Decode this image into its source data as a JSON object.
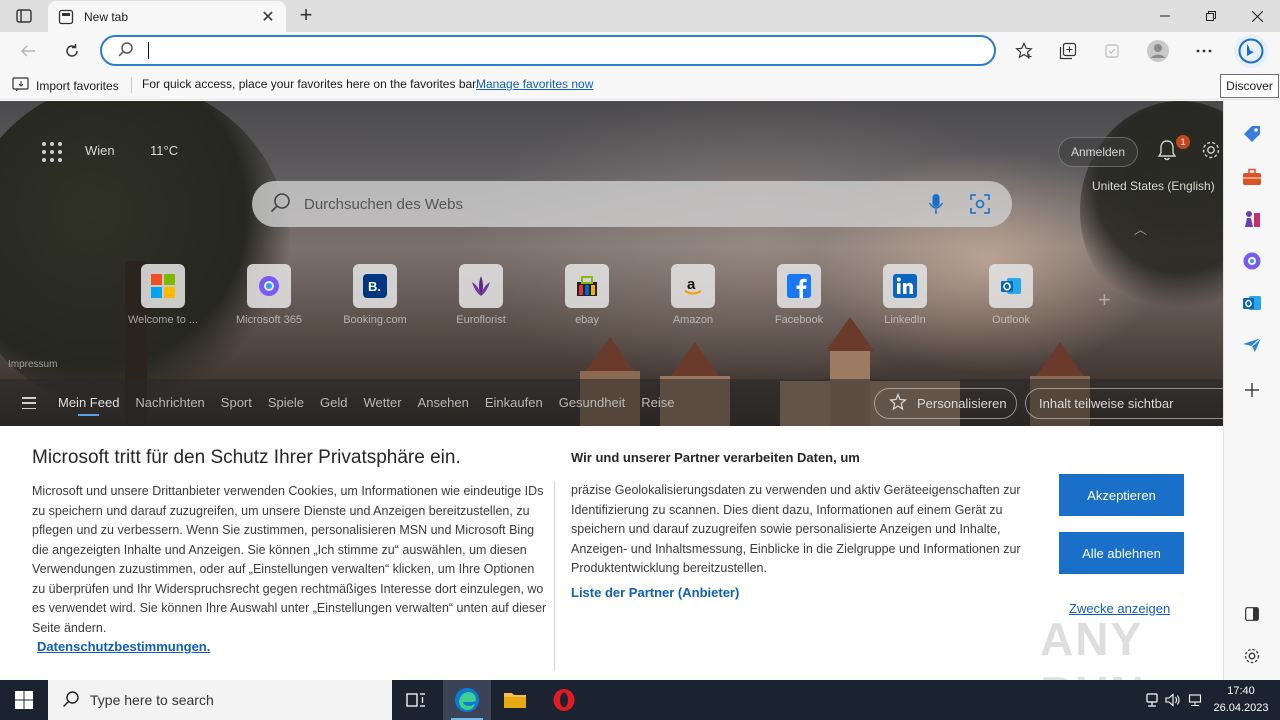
{
  "browser": {
    "tab_title": "New tab",
    "address_value": "",
    "favorites_bar": {
      "import_label": "Import favorites",
      "message": "For quick access, place your favorites here on the favorites bar.",
      "manage_link": "Manage favorites now"
    },
    "tooltip": "Discover"
  },
  "newtab": {
    "weather": {
      "city": "Wien",
      "temp": "11°C"
    },
    "signin_label": "Anmelden",
    "notification_count": "1",
    "region": "United States (English)",
    "search_placeholder": "Durchsuchen des Webs",
    "tiles": [
      {
        "label": "Welcome to ...",
        "icon": "microsoft-logo-icon"
      },
      {
        "label": "Microsoft 365",
        "icon": "microsoft365-icon"
      },
      {
        "label": "Booking.com",
        "icon": "booking-icon"
      },
      {
        "label": "Euroflorist",
        "icon": "euroflorist-icon"
      },
      {
        "label": "ebay",
        "icon": "ebay-icon"
      },
      {
        "label": "Amazon",
        "icon": "amazon-icon"
      },
      {
        "label": "Facebook",
        "icon": "facebook-icon"
      },
      {
        "label": "LinkedIn",
        "icon": "linkedin-icon"
      },
      {
        "label": "Outlook",
        "icon": "outlook-icon"
      }
    ],
    "impressum": "Impressum",
    "feed_tabs": [
      "Mein Feed",
      "Nachrichten",
      "Sport",
      "Spiele",
      "Geld",
      "Wetter",
      "Ansehen",
      "Einkaufen",
      "Gesundheit",
      "Reise"
    ],
    "personalize_label": "Personalisieren",
    "visibility_label": "Inhalt teilweise sichtbar"
  },
  "consent": {
    "title": "Microsoft tritt für den Schutz Ihrer Privatsphäre ein.",
    "body": "Microsoft und unsere Drittanbieter verwenden Cookies, um Informationen wie eindeutige IDs zu speichern und darauf zuzugreifen, um unsere Dienste und Anzeigen bereitzustellen, zu pflegen und zu verbessern. Wenn Sie zustimmen, personalisieren MSN und Microsoft Bing die angezeigten Inhalte und Anzeigen. Sie können „Ich stimme zu“ auswählen, um diesen Verwendungen zuzustimmen, oder auf „Einstellungen verwalten“ klicken, um Ihre Optionen zu überprüfen und Ihr Widerspruchsrecht gegen rechtmäßiges Interesse dort einzulegen, wo es verwendet wird.  Sie können Ihre Auswahl unter „Einstellungen verwalten“ unten auf dieser Seite ändern.",
    "privacy_link": "Datenschutzbestimmungen.",
    "subtitle": "Wir und unserer Partner verarbeiten Daten, um",
    "body2": "präzise Geolokalisierungsdaten zu verwenden und aktiv Geräteeigenschaften zur Identifizierung zu scannen. Dies dient dazu, Informationen auf einem Gerät zu speichern und darauf zuzugreifen sowie personalisierte Anzeigen und Inhalte, Anzeigen- und Inhaltsmessung, Einblicke in die Zielgruppe und Informationen zur Produktentwicklung bereitzustellen.",
    "partners_link": "Liste der Partner (Anbieter)",
    "accept_label": "Akzeptieren",
    "reject_label": "Alle ablehnen",
    "purposes_link": "Zwecke anzeigen"
  },
  "watermark": "ANY RUN",
  "taskbar": {
    "search_placeholder": "Type here to search",
    "time": "17:40",
    "date": "26.04.2023"
  },
  "colors": {
    "accent": "#1a6fc9",
    "link": "#0f5fb3",
    "taskbar": "#1c2330"
  }
}
